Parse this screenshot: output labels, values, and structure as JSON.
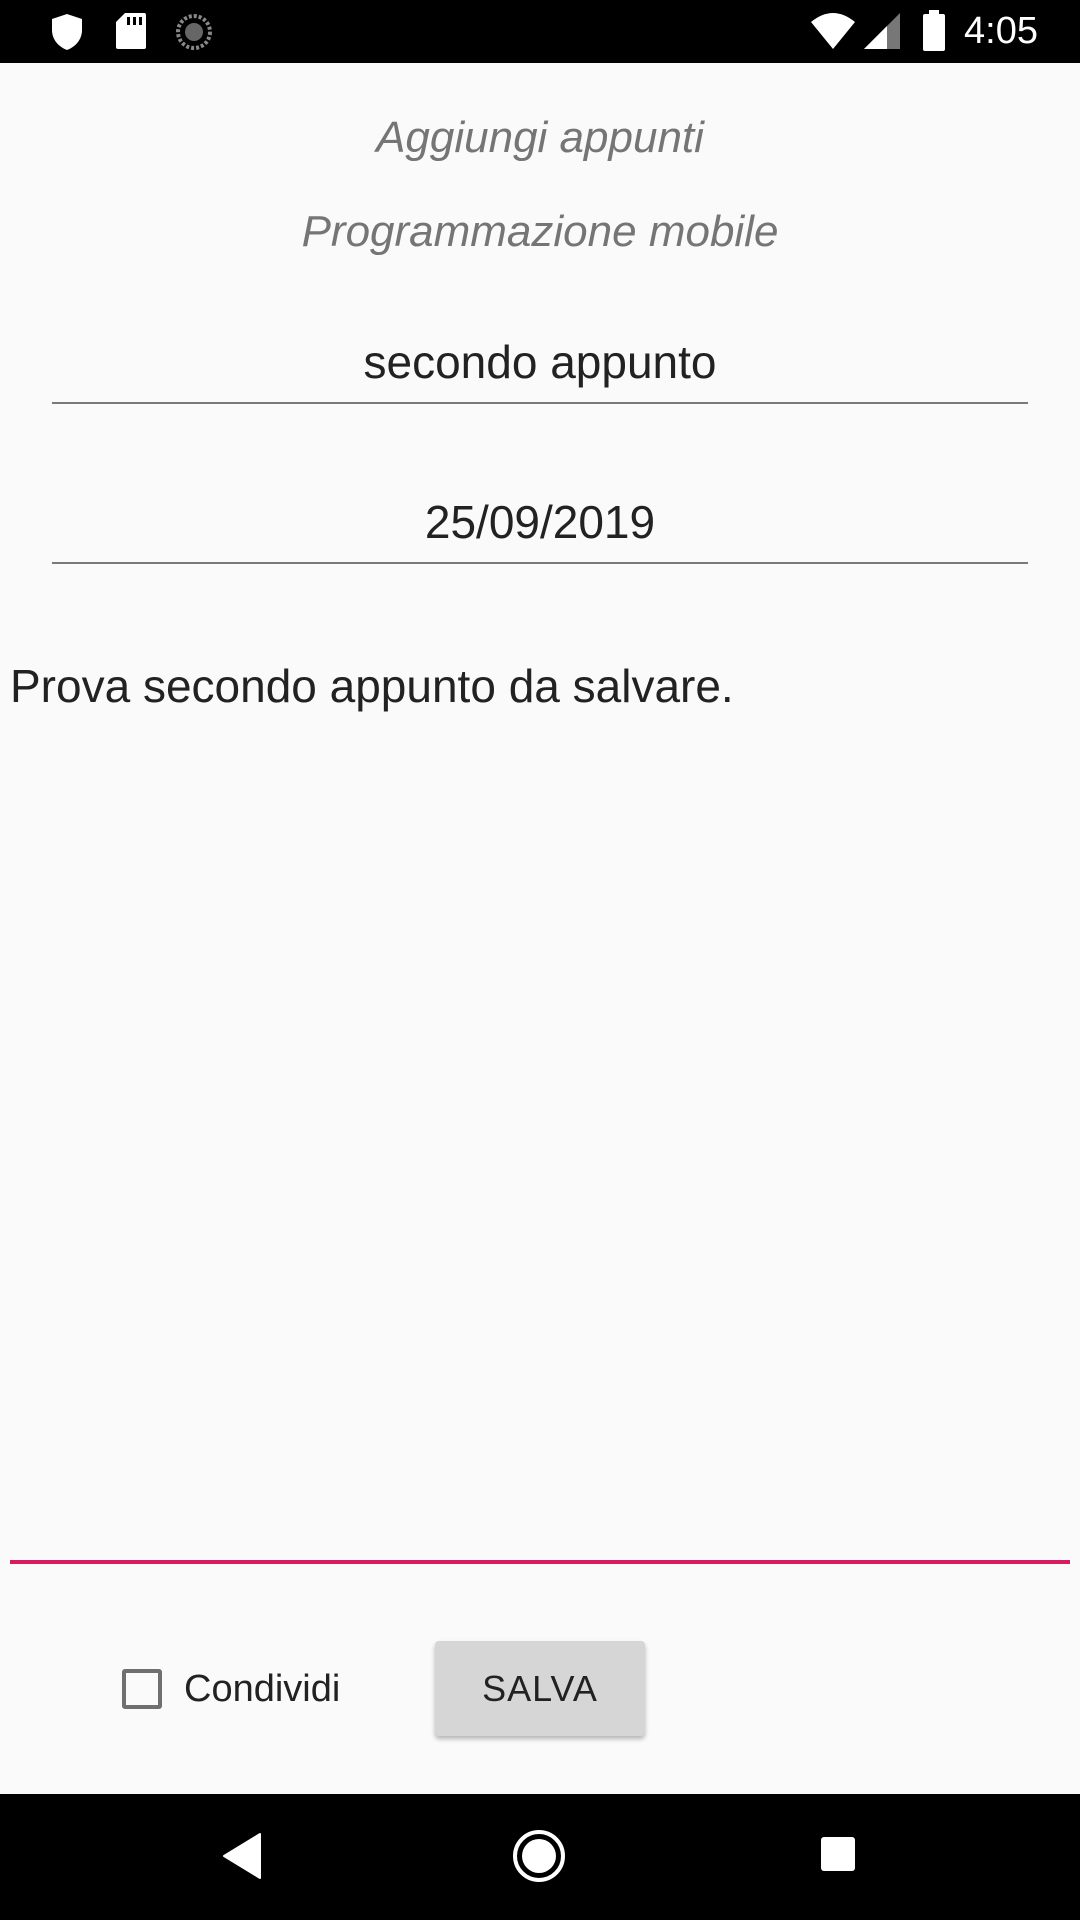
{
  "status_bar": {
    "time": "4:05",
    "icons": [
      "shield-icon",
      "sd-card-icon",
      "sync-icon",
      "wifi-icon",
      "signal-icon",
      "battery-icon"
    ]
  },
  "header": {
    "title": "Aggiungi appunti",
    "course": "Programmazione mobile"
  },
  "form": {
    "note_name": "secondo appunto",
    "note_date": "25/09/2019",
    "note_body": "Prova secondo appunto da salvare.",
    "share_label": "Condividi",
    "share_checked": false,
    "save_label": "SALVA"
  },
  "nav_bar": {
    "icons": [
      "back-icon",
      "home-icon",
      "recents-icon"
    ]
  },
  "colors": {
    "accent": "#d81b60",
    "background": "#fafafa",
    "button": "#d6d6d6"
  }
}
